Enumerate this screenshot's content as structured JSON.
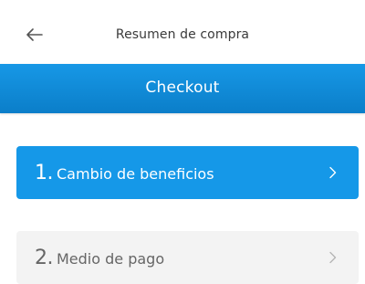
{
  "topbar": {
    "back_icon": "arrow-left-icon",
    "title": "Resumen de compra"
  },
  "header": {
    "title": "Checkout"
  },
  "steps": [
    {
      "number": "1.",
      "label": "Cambio de beneficios",
      "active": true,
      "icon": "chevron-right-icon"
    },
    {
      "number": "2.",
      "label": "Medio de pago",
      "active": false,
      "icon": "chevron-right-icon"
    }
  ],
  "colors": {
    "primary": "#1598e8",
    "inactive_bg": "#f3f3f3",
    "inactive_text": "#666666"
  }
}
